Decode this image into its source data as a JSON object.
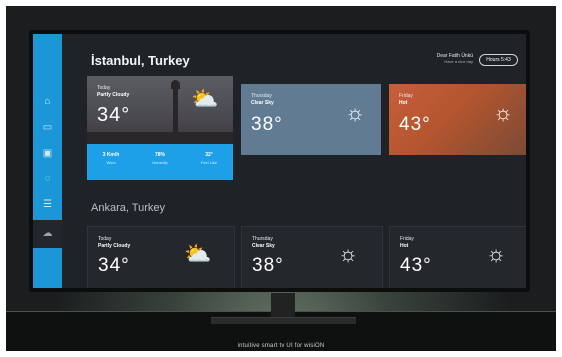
{
  "caption": "intuitive smart tv UI for wisiON",
  "greeting": {
    "name": "Dear Fatih Ünkü",
    "sub": "Have a nice day",
    "time": "Hours 5:43"
  },
  "sidebar": {
    "icons": [
      "home-icon",
      "folder-icon",
      "media-icon",
      "chat-icon",
      "list-icon",
      "cloud-icon"
    ]
  },
  "cities": [
    {
      "name": "İstanbul, Turkey",
      "today": {
        "day": "Today",
        "condition": "Partly Cloudy",
        "temp": "34°",
        "stats": [
          {
            "value": "3 Km/h",
            "label": "Wind"
          },
          {
            "value": "78%",
            "label": "Humidity"
          },
          {
            "value": "32°",
            "label": "Feel Like"
          }
        ]
      },
      "forecast": [
        {
          "day": "Thursday",
          "condition": "Clear Sky",
          "temp": "38°"
        },
        {
          "day": "Friday",
          "condition": "Hot",
          "temp": "43°"
        }
      ]
    },
    {
      "name": "Ankara, Turkey",
      "today": {
        "day": "Today",
        "condition": "Partly Cloudy",
        "temp": "34°"
      },
      "forecast": [
        {
          "day": "Thursday",
          "condition": "Clear Sky",
          "temp": "38°"
        },
        {
          "day": "Friday",
          "condition": "Hot",
          "temp": "43°"
        }
      ]
    }
  ],
  "colors": {
    "accent": "#1b96d6",
    "stats_bar": "#1da0e8",
    "thursday_card": "#617b92",
    "friday_card": "#c65f3a"
  }
}
